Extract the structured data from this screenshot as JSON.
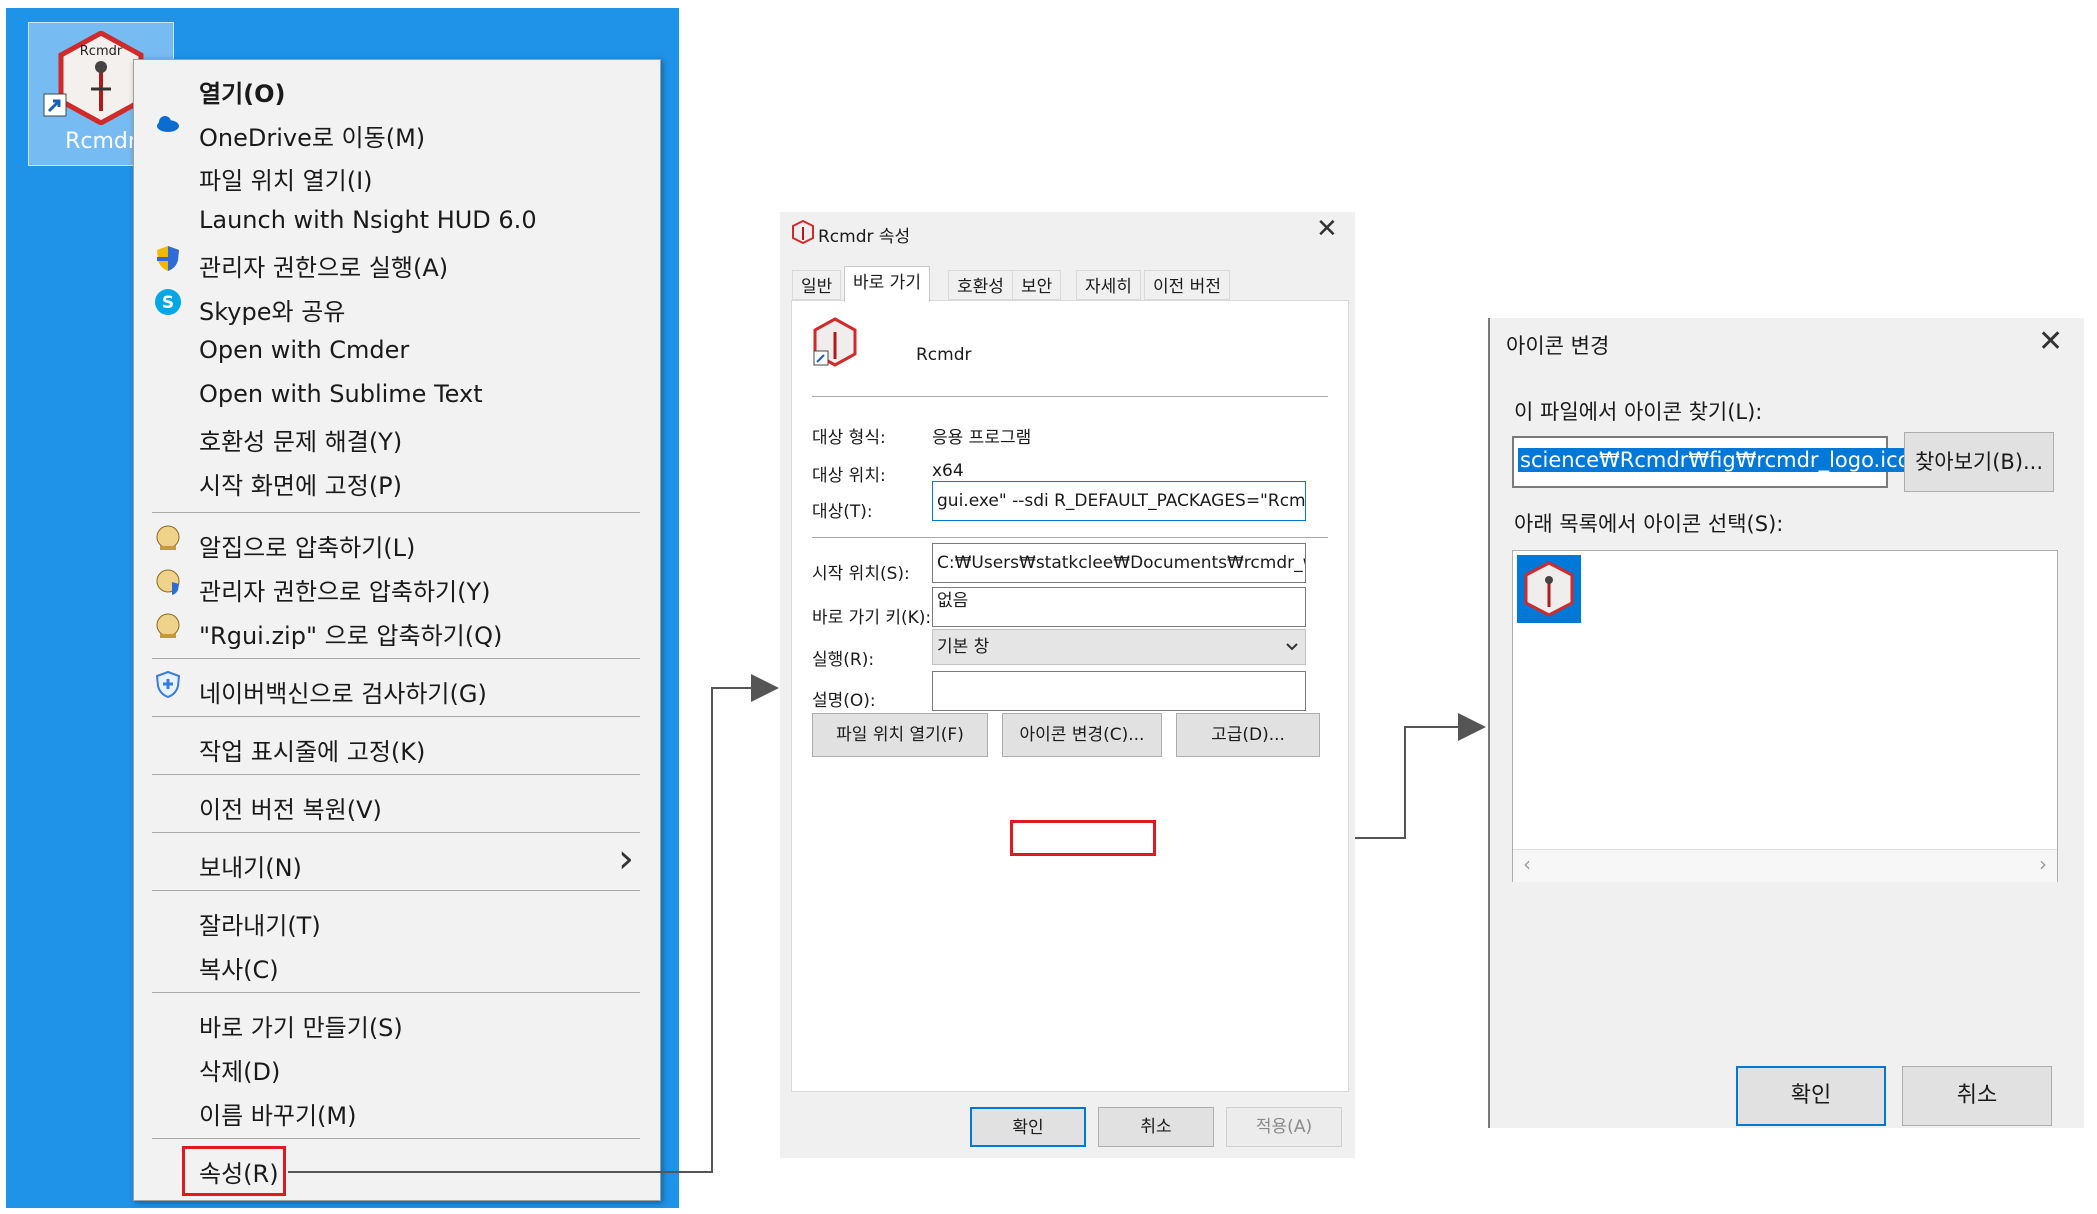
{
  "desktop": {
    "icon_label": "Rcmdr",
    "icon_text": "Rcmdr"
  },
  "context_menu": {
    "items": [
      {
        "label": "열기(O)"
      },
      {
        "label": "OneDrive로 이동(M)"
      },
      {
        "label": "파일 위치 열기(I)"
      },
      {
        "label": "Launch with Nsight HUD 6.0"
      },
      {
        "label": "관리자 권한으로 실행(A)"
      },
      {
        "label": "Skype와 공유"
      },
      {
        "label": "Open with Cmder"
      },
      {
        "label": "Open with Sublime Text"
      },
      {
        "label": "호환성 문제 해결(Y)"
      },
      {
        "label": "시작 화면에 고정(P)"
      },
      {
        "label": "알집으로 압축하기(L)"
      },
      {
        "label": "관리자 권한으로 압축하기(Y)"
      },
      {
        "label": "\"Rgui.zip\" 으로 압축하기(Q)"
      },
      {
        "label": "네이버백신으로 검사하기(G)"
      },
      {
        "label": "작업 표시줄에 고정(K)"
      },
      {
        "label": "이전 버전 복원(V)"
      },
      {
        "label": "보내기(N)"
      },
      {
        "label": "잘라내기(T)"
      },
      {
        "label": "복사(C)"
      },
      {
        "label": "바로 가기 만들기(S)"
      },
      {
        "label": "삭제(D)"
      },
      {
        "label": "이름 바꾸기(M)"
      },
      {
        "label": "속성(R)"
      }
    ],
    "submenu_arrow": "›"
  },
  "properties": {
    "title": "Rcmdr 속성",
    "close": "✕",
    "tabs": [
      "일반",
      "바로 가기",
      "호환성",
      "보안",
      "자세히",
      "이전 버전"
    ],
    "active_tab": "바로 가기",
    "app_name": "Rcmdr",
    "target_type_label": "대상 형식:",
    "target_type_value": "응용 프로그램",
    "target_location_label": "대상 위치:",
    "target_location_value": "x64",
    "target_label": "대상(T):",
    "target_value": "gui.exe\" --sdi R_DEFAULT_PACKAGES=\"Rcmdr\"",
    "start_in_label": "시작 위치(S):",
    "start_in_value": "C:₩Users₩statkclee₩Documents₩rcmdr_works",
    "shortcut_key_label": "바로 가기 키(K):",
    "shortcut_key_value": "없음",
    "run_label": "실행(R):",
    "run_value": "기본 창",
    "comment_label": "설명(O):",
    "comment_value": "",
    "btn_open_location": "파일 위치 열기(F)",
    "btn_change_icon": "아이콘 변경(C)...",
    "btn_advanced": "고급(D)...",
    "btn_ok": "확인",
    "btn_cancel": "취소",
    "btn_apply": "적용(A)"
  },
  "change_icon": {
    "title": "아이콘 변경",
    "close": "✕",
    "find_label": "이 파일에서 아이콘 찾기(L):",
    "path_value": "science₩Rcmdr₩fig₩rcmdr_logo.ico",
    "browse_label": "찾아보기(B)...",
    "select_label": "아래 목록에서 아이콘 선택(S):",
    "scroll_left": "‹",
    "scroll_right": "›",
    "ok": "확인",
    "cancel": "취소"
  },
  "colors": {
    "desktop": "#1f93e8",
    "highlight": "#e0191e",
    "accent": "#0078d7"
  }
}
